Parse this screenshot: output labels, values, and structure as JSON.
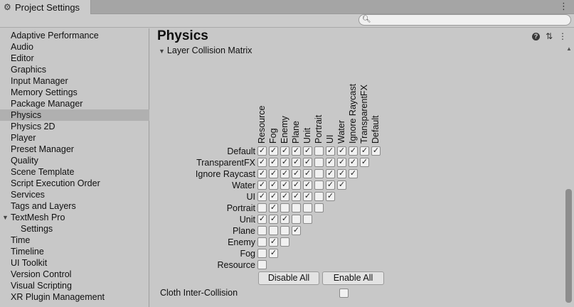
{
  "window": {
    "tab_title": "Project Settings"
  },
  "search": {
    "placeholder": ""
  },
  "sidebar": {
    "items": [
      "Adaptive Performance",
      "Audio",
      "Editor",
      "Graphics",
      "Input Manager",
      "Memory Settings",
      "Package Manager",
      "Physics",
      "Physics 2D",
      "Player",
      "Preset Manager",
      "Quality",
      "Scene Template",
      "Script Execution Order",
      "Services",
      "Tags and Layers",
      "TextMesh Pro",
      "Settings",
      "Time",
      "Timeline",
      "UI Toolkit",
      "Version Control",
      "Visual Scripting",
      "XR Plugin Management"
    ],
    "selected": "Physics"
  },
  "main": {
    "title": "Physics",
    "foldout_label": "Layer Collision Matrix",
    "matrix": {
      "columns": [
        "Resource",
        "Fog",
        "Enemy",
        "Plane",
        "Unit",
        "Portrait",
        "UI",
        "Water",
        "Ignore Raycast",
        "TransparentFX",
        "Default"
      ],
      "rows": [
        {
          "label": "Default",
          "checks": [
            true,
            true,
            true,
            true,
            true,
            false,
            true,
            true,
            true,
            true,
            true
          ]
        },
        {
          "label": "TransparentFX",
          "checks": [
            true,
            true,
            true,
            true,
            true,
            false,
            true,
            true,
            true,
            true
          ]
        },
        {
          "label": "Ignore Raycast",
          "checks": [
            true,
            true,
            true,
            true,
            true,
            false,
            true,
            true,
            true
          ]
        },
        {
          "label": "Water",
          "checks": [
            true,
            true,
            true,
            true,
            true,
            false,
            true,
            true
          ]
        },
        {
          "label": "UI",
          "checks": [
            true,
            true,
            true,
            true,
            true,
            false,
            true
          ]
        },
        {
          "label": "Portrait",
          "checks": [
            false,
            true,
            false,
            false,
            false,
            false
          ]
        },
        {
          "label": "Unit",
          "checks": [
            true,
            true,
            true,
            false,
            false
          ]
        },
        {
          "label": "Plane",
          "checks": [
            false,
            false,
            false,
            true
          ]
        },
        {
          "label": "Enemy",
          "checks": [
            false,
            true,
            false
          ]
        },
        {
          "label": "Fog",
          "checks": [
            false,
            true
          ]
        },
        {
          "label": "Resource",
          "checks": [
            false
          ]
        }
      ]
    },
    "disable_all_label": "Disable All",
    "enable_all_label": "Enable All",
    "cloth_label": "Cloth Inter-Collision",
    "cloth_checked": false
  }
}
